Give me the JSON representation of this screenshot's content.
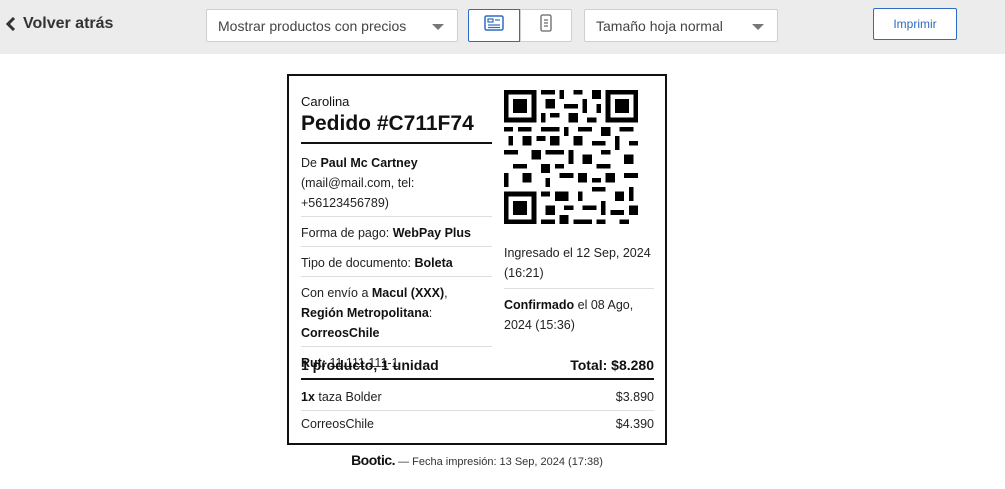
{
  "toolbar": {
    "back_label": "Volver atrás",
    "products_select": "Mostrar productos con precios",
    "size_select": "Tamaño hoja normal",
    "print_label": "Imprimir",
    "accent_color": "#2e6bc2"
  },
  "ticket": {
    "store": "Carolina",
    "order_title": "Pedido #C711F74",
    "from_prefix": "De ",
    "customer_name": "Paul Mc Cartney",
    "customer_contact": "(mail@mail.com, tel: +56123456789)",
    "payment_label": "Forma de pago: ",
    "payment_value": "WebPay Plus",
    "doc_label": "Tipo de documento: ",
    "doc_value": "Boleta",
    "shipping_prefix": "Con envío a ",
    "shipping_city": "Macul (XXX)",
    "shipping_sep": ", ",
    "shipping_region": "Región Metropolitana",
    "shipping_colon": ": ",
    "shipping_carrier": "CorreosChile",
    "rut_label": "Rut:",
    "rut_value": " 11.111.111-1",
    "ingresado": "Ingresado el 12 Sep, 2024 (16:21)",
    "confirmado_label": "Confirmado",
    "confirmado_rest": " el 08 Ago, 2024 (15:36)",
    "summary_items": "1 producto, 1 unidad",
    "summary_total": "Total: $8.280",
    "lines": [
      {
        "qty": "1x",
        "name": " taza Bolder",
        "price": "$3.890"
      },
      {
        "qty": "",
        "name": "CorreosChile",
        "price": "$4.390"
      }
    ]
  },
  "footer": {
    "brand": "Bootic.",
    "text": " — Fecha impresión: 13 Sep, 2024 (17:38)"
  }
}
